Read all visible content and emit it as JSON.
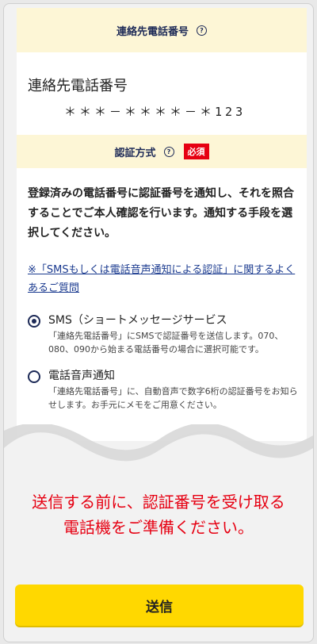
{
  "phone_section": {
    "header": "連絡先電話番号",
    "help_icon": "question-circle-icon",
    "label": "連絡先電話番号",
    "value": "＊＊＊－＊＊＊＊－＊123"
  },
  "auth_section": {
    "header": "認証方式",
    "help_icon": "question-circle-icon",
    "required_badge": "必須",
    "description": "登録済みの電話番号に認証番号を通知し、それを照合することでご本人確認を行います。通知する手段を選択してください。",
    "faq_link": "※「SMSもしくは電話音声通知による認証」に関するよくあるご質問",
    "options": [
      {
        "title": "SMS（ショートメッセージサービス",
        "desc": "「連絡先電話番号」にSMSで認証番号を送信します。070、080、090から始まる電話番号の場合に選択可能です。",
        "selected": true
      },
      {
        "title": "電話音声通知",
        "desc": "「連絡先電話番号」に、自動音声で数字6桁の認証番号をお知らせします。お手元にメモをご用意ください。",
        "selected": false
      }
    ]
  },
  "warning": {
    "line1": "送信する前に、認証番号を受け取る",
    "line2": "電話機をご準備ください。"
  },
  "submit_label": "送信",
  "colors": {
    "accent_yellow": "#ffd800",
    "header_bg": "#fdf6d6",
    "warning_red": "#e60012",
    "navy": "#1d2a57"
  }
}
